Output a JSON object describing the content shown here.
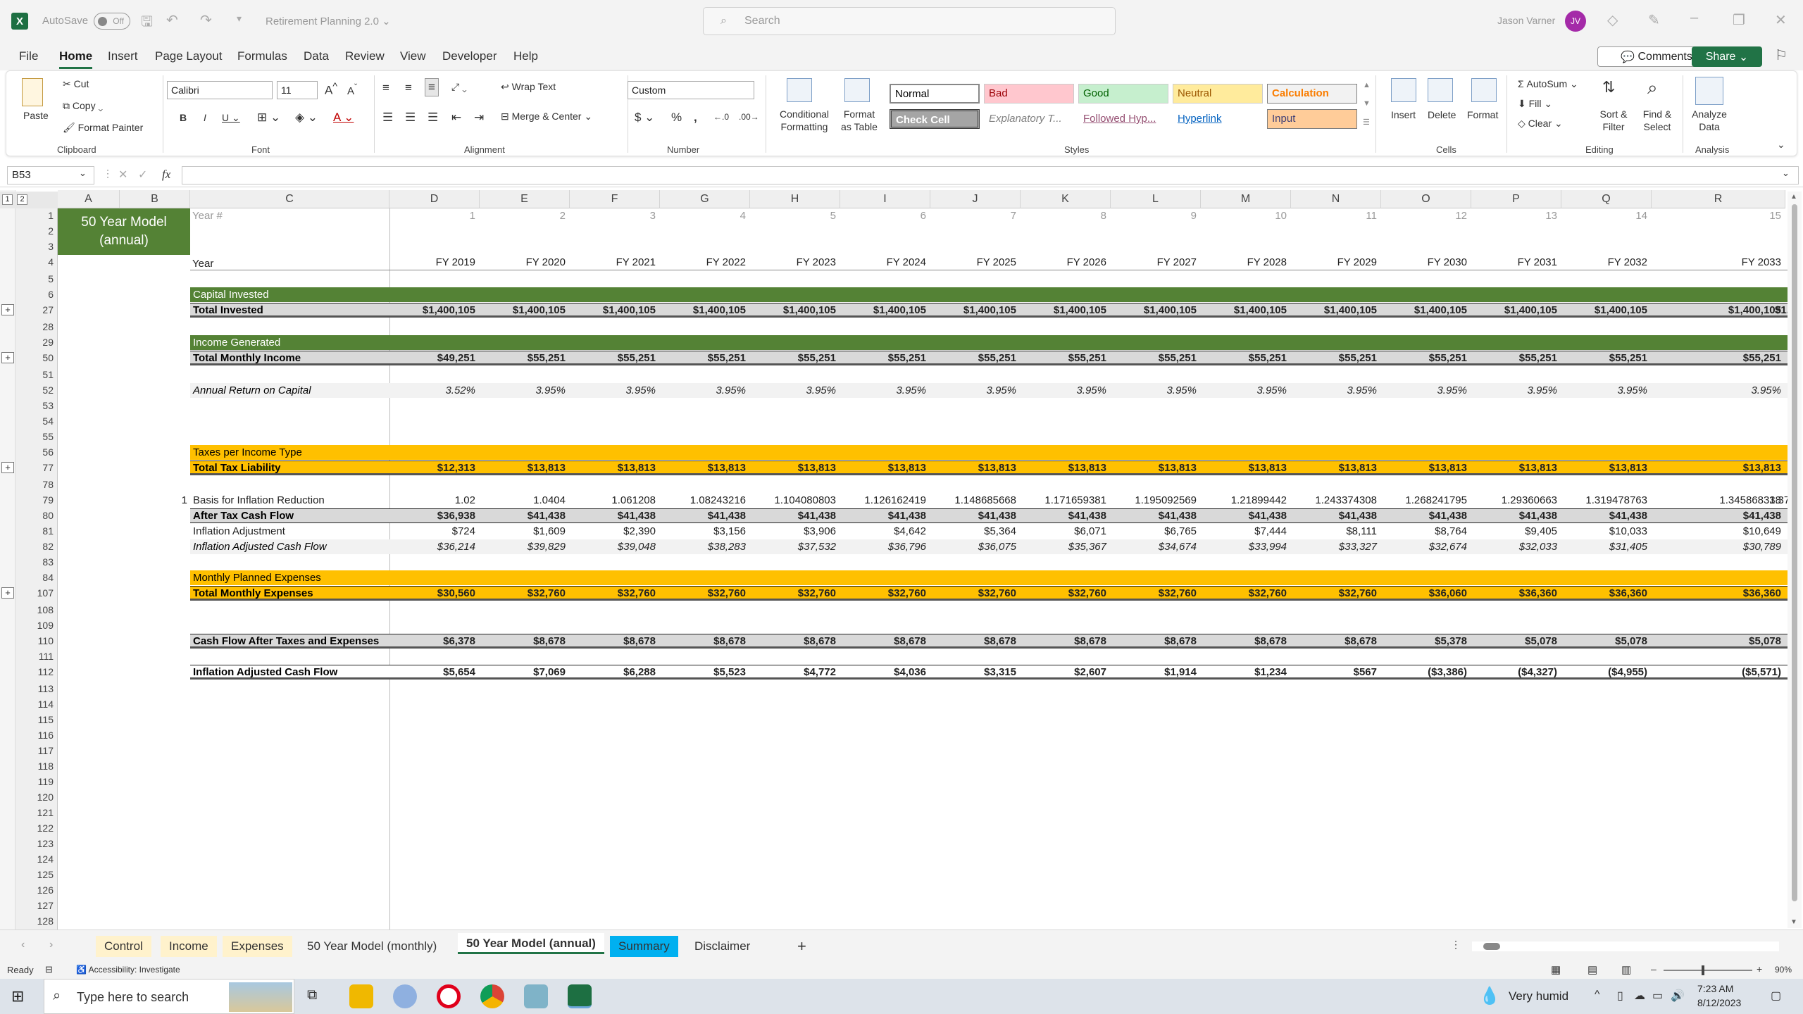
{
  "title": {
    "autosave": "AutoSave",
    "autosave_state": "Off",
    "doc": "Retirement Planning 2.0 ⌄",
    "search_placeholder": "Search",
    "user": "Jason Varner",
    "initials": "JV"
  },
  "menu": {
    "items": [
      "File",
      "Home",
      "Insert",
      "Page Layout",
      "Formulas",
      "Data",
      "Review",
      "View",
      "Developer",
      "Help"
    ],
    "active": "Home",
    "comments": "Comments",
    "share": "Share"
  },
  "ribbon": {
    "paste": "Paste",
    "cut": "Cut",
    "copy": "Copy",
    "format_painter": "Format Painter",
    "clipboard": "Clipboard",
    "font_name": "Calibri",
    "font_size": "11",
    "font": "Font",
    "wrap_text": "Wrap Text",
    "merge_center": "Merge & Center",
    "alignment": "Alignment",
    "number_format": "Custom",
    "number": "Number",
    "conditional_formatting": "Conditional Formatting",
    "format_as_table": "Format as Table",
    "styles": "Styles",
    "style_cells": [
      {
        "label": "Normal",
        "bg": "#ffffff",
        "fg": "#000000"
      },
      {
        "label": "Bad",
        "bg": "#ffc7ce",
        "fg": "#9c0006"
      },
      {
        "label": "Good",
        "bg": "#c6efce",
        "fg": "#006100"
      },
      {
        "label": "Neutral",
        "bg": "#ffeb9c",
        "fg": "#9c5700"
      },
      {
        "label": "Calculation",
        "bg": "#f2f2f2",
        "fg": "#fa7d00"
      },
      {
        "label": "Check Cell",
        "bg": "#a5a5a5",
        "fg": "#ffffff"
      },
      {
        "label": "Explanatory T...",
        "bg": "#ffffff",
        "fg": "#7f7f7f"
      },
      {
        "label": "Followed Hyp...",
        "bg": "#ffffff",
        "fg": "#954f72"
      },
      {
        "label": "Hyperlink",
        "bg": "#ffffff",
        "fg": "#0563c1"
      },
      {
        "label": "Input",
        "bg": "#ffcc99",
        "fg": "#3f3f76"
      }
    ],
    "insert": "Insert",
    "delete": "Delete",
    "format": "Format",
    "cells": "Cells",
    "autosum": "AutoSum",
    "fill": "Fill",
    "clear": "Clear",
    "sort_filter": "Sort & Filter",
    "find_select": "Find & Select",
    "editing": "Editing",
    "analyze_data": "Analyze Data",
    "analysis": "Analysis"
  },
  "formula": {
    "namebox": "B53",
    "fx": "fx",
    "content": ""
  },
  "grid": {
    "columns": [
      "A",
      "B",
      "C",
      "D",
      "E",
      "F",
      "G",
      "H",
      "I",
      "J",
      "K",
      "L",
      "M",
      "N",
      "O",
      "P",
      "Q",
      "R"
    ],
    "model_title": "50 Year Model (annual)",
    "year_num_label": "Year #",
    "year_label": "Year",
    "year_nums": [
      "1",
      "2",
      "3",
      "4",
      "5",
      "6",
      "7",
      "8",
      "9",
      "10",
      "11",
      "12",
      "13",
      "14",
      "15"
    ],
    "fiscal_years": [
      "FY 2019",
      "FY 2020",
      "FY 2021",
      "FY 2022",
      "FY 2023",
      "FY 2024",
      "FY 2025",
      "FY 2026",
      "FY 2027",
      "FY 2028",
      "FY 2029",
      "FY 2030",
      "FY 2031",
      "FY 2032",
      "FY 2033"
    ],
    "row_numbers": [
      "1",
      "2",
      "3",
      "4",
      "5",
      "6",
      "27",
      "28",
      "29",
      "50",
      "51",
      "52",
      "53",
      "54",
      "55",
      "56",
      "77",
      "78",
      "79",
      "80",
      "81",
      "82",
      "83",
      "84",
      "107",
      "108",
      "109",
      "110",
      "111",
      "112",
      "113",
      "114",
      "115",
      "116",
      "117",
      "118",
      "119",
      "120",
      "121",
      "122",
      "123",
      "124",
      "125",
      "126",
      "127",
      "128"
    ],
    "sections": {
      "capital_invested": "Capital Invested",
      "total_invested": "Total Invested",
      "income_generated": "Income Generated",
      "total_monthly_income": "Total Monthly Income",
      "annual_return": "Annual Return on Capital",
      "taxes_per_income": "Taxes per Income Type",
      "total_tax_liability": "Total Tax Liability",
      "basis_label": "Basis for Inflation Reduction",
      "basis_marker": "1",
      "after_tax": "After Tax Cash Flow",
      "inflation_adj": "Inflation Adjustment",
      "infl_adj_cf": "Inflation Adjusted Cash Flow",
      "monthly_planned": "Monthly Planned Expenses",
      "total_monthly_expenses": "Total Monthly Expenses",
      "cf_after": "Cash Flow After Taxes and Expenses",
      "infl_adj_cf2": "Inflation Adjusted Cash Flow"
    },
    "total_invested": [
      "$1,400,105",
      "$1,400,105",
      "$1,400,105",
      "$1,400,105",
      "$1,400,105",
      "$1,400,105",
      "$1,400,105",
      "$1,400,105",
      "$1,400,105",
      "$1,400,105",
      "$1,400,105",
      "$1,400,105",
      "$1,400,105",
      "$1,400,105",
      "$1,400,105"
    ],
    "total_invested_overflow": "$1,",
    "total_monthly_income": [
      "$49,251",
      "$55,251",
      "$55,251",
      "$55,251",
      "$55,251",
      "$55,251",
      "$55,251",
      "$55,251",
      "$55,251",
      "$55,251",
      "$55,251",
      "$55,251",
      "$55,251",
      "$55,251",
      "$55,251"
    ],
    "annual_return": [
      "3.52%",
      "3.95%",
      "3.95%",
      "3.95%",
      "3.95%",
      "3.95%",
      "3.95%",
      "3.95%",
      "3.95%",
      "3.95%",
      "3.95%",
      "3.95%",
      "3.95%",
      "3.95%",
      "3.95%"
    ],
    "total_tax": [
      "$12,313",
      "$13,813",
      "$13,813",
      "$13,813",
      "$13,813",
      "$13,813",
      "$13,813",
      "$13,813",
      "$13,813",
      "$13,813",
      "$13,813",
      "$13,813",
      "$13,813",
      "$13,813",
      "$13,813"
    ],
    "basis": [
      "1.02",
      "1.0404",
      "1.061208",
      "1.08243216",
      "1.104080803",
      "1.126162419",
      "1.148685668",
      "1.171659381",
      "1.195092569",
      "1.21899442",
      "1.243374308",
      "1.268241795",
      "1.29360663",
      "1.319478763",
      "1.345868338"
    ],
    "basis_overflow": "1.37",
    "after_tax": [
      "$36,938",
      "$41,438",
      "$41,438",
      "$41,438",
      "$41,438",
      "$41,438",
      "$41,438",
      "$41,438",
      "$41,438",
      "$41,438",
      "$41,438",
      "$41,438",
      "$41,438",
      "$41,438",
      "$41,438"
    ],
    "inflation_adj": [
      "$724",
      "$1,609",
      "$2,390",
      "$3,156",
      "$3,906",
      "$4,642",
      "$5,364",
      "$6,071",
      "$6,765",
      "$7,444",
      "$8,111",
      "$8,764",
      "$9,405",
      "$10,033",
      "$10,649"
    ],
    "infl_adj_cf": [
      "$36,214",
      "$39,829",
      "$39,048",
      "$38,283",
      "$37,532",
      "$36,796",
      "$36,075",
      "$35,367",
      "$34,674",
      "$33,994",
      "$33,327",
      "$32,674",
      "$32,033",
      "$31,405",
      "$30,789"
    ],
    "total_expenses": [
      "$30,560",
      "$32,760",
      "$32,760",
      "$32,760",
      "$32,760",
      "$32,760",
      "$32,760",
      "$32,760",
      "$32,760",
      "$32,760",
      "$32,760",
      "$36,060",
      "$36,360",
      "$36,360",
      "$36,360"
    ],
    "cf_after": [
      "$6,378",
      "$8,678",
      "$8,678",
      "$8,678",
      "$8,678",
      "$8,678",
      "$8,678",
      "$8,678",
      "$8,678",
      "$8,678",
      "$8,678",
      "$5,378",
      "$5,078",
      "$5,078",
      "$5,078"
    ],
    "infl_adj_cf2": [
      "$5,654",
      "$7,069",
      "$6,288",
      "$5,523",
      "$4,772",
      "$4,036",
      "$3,315",
      "$2,607",
      "$1,914",
      "$1,234",
      "$567",
      "($3,386)",
      "($4,327)",
      "($4,955)",
      "($5,571)"
    ]
  },
  "tabs": [
    {
      "label": "Control",
      "bg": "#fff2cc"
    },
    {
      "label": "Income",
      "bg": "#fff2cc"
    },
    {
      "label": "Expenses",
      "bg": "#fff2cc"
    },
    {
      "label": "50 Year Model (monthly)",
      "bg": ""
    },
    {
      "label": "50 Year Model (annual)",
      "bg": "#ffffff",
      "active": true
    },
    {
      "label": "Summary",
      "bg": "#00b0f0"
    },
    {
      "label": "Disclaimer",
      "bg": ""
    }
  ],
  "status": {
    "ready": "Ready",
    "accessibility": "Accessibility: Investigate",
    "zoom": "90%"
  },
  "taskbar": {
    "search_placeholder": "Type here to search",
    "weather": "Very humid",
    "time": "7:23 AM",
    "date": "8/12/2023"
  },
  "colors": {
    "green_header": "#548235",
    "dark_green_band": "#548235",
    "orange_band": "#ffc000",
    "grey_total": "#d9d9d9",
    "accent": "#217346"
  }
}
